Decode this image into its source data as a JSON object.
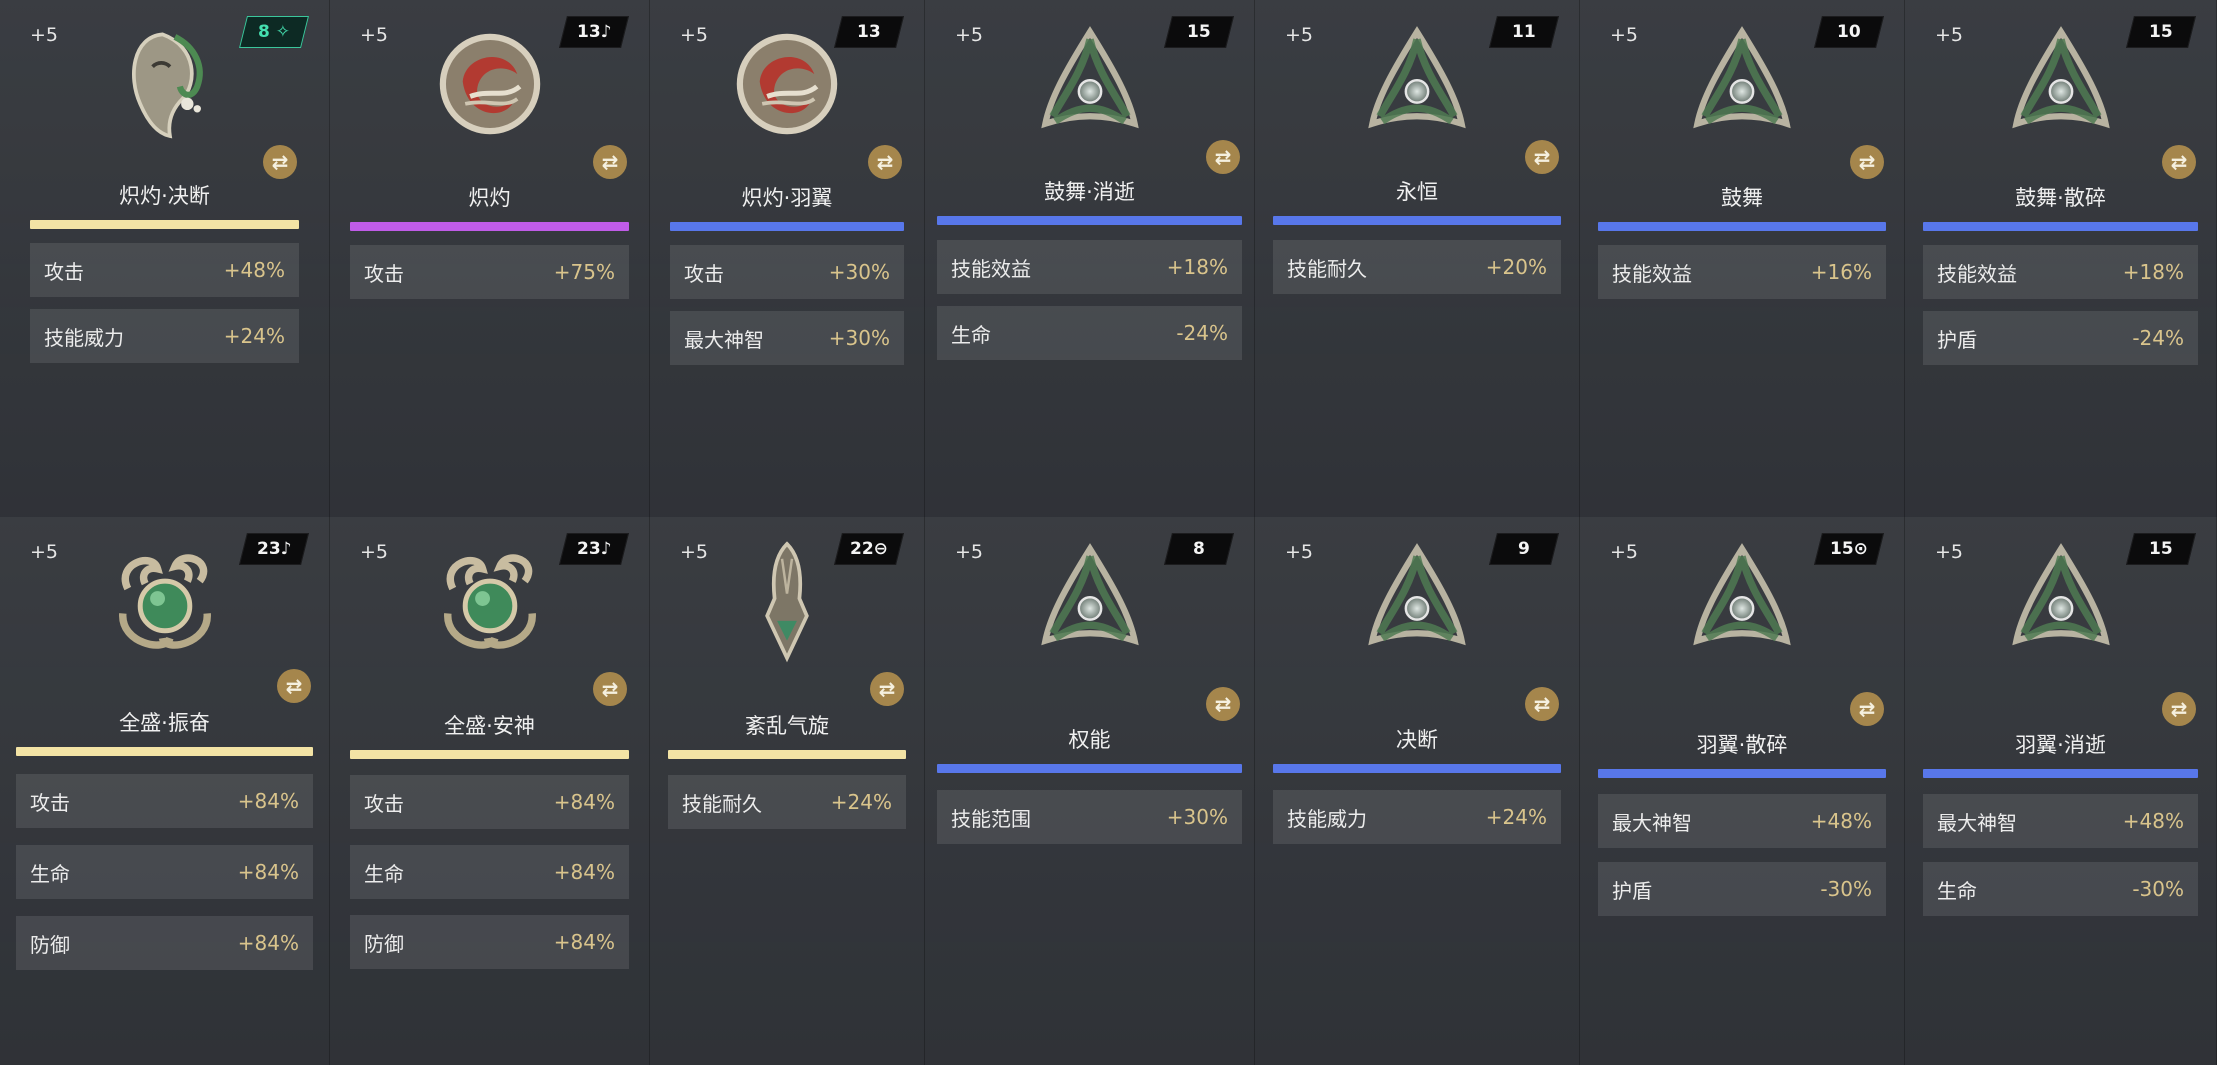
{
  "colors": {
    "gold": "#f3e3a5",
    "purple": "#c05ce8",
    "blue": "#5877ea",
    "value": "#d9c48c",
    "swap": "#a5864c"
  },
  "cards": [
    {
      "level": "+5",
      "badge": "8 ✧",
      "badge_style": "green",
      "icon": "mask-icon",
      "name": "炽灼·决断",
      "bar": "gold",
      "stats": [
        {
          "label": "攻击",
          "value": "+48%"
        },
        {
          "label": "技能威力",
          "value": "+24%"
        }
      ]
    },
    {
      "level": "+5",
      "badge": "13♪",
      "badge_style": "dark",
      "icon": "swirl-icon",
      "name": "炽灼",
      "bar": "purple",
      "stats": [
        {
          "label": "攻击",
          "value": "+75%"
        }
      ]
    },
    {
      "level": "+5",
      "badge": "13",
      "badge_style": "dark",
      "icon": "swirl-icon",
      "name": "炽灼·羽翼",
      "bar": "blue",
      "stats": [
        {
          "label": "攻击",
          "value": "+30%"
        },
        {
          "label": "最大神智",
          "value": "+30%"
        }
      ]
    },
    {
      "level": "+5",
      "badge": "15",
      "badge_style": "dark",
      "icon": "triquetra-icon",
      "name": "鼓舞·消逝",
      "bar": "blue",
      "stats": [
        {
          "label": "技能效益",
          "value": "+18%"
        },
        {
          "label": "生命",
          "value": "-24%"
        }
      ]
    },
    {
      "level": "+5",
      "badge": "11",
      "badge_style": "dark",
      "icon": "triquetra-icon",
      "name": "永恒",
      "bar": "blue",
      "stats": [
        {
          "label": "技能耐久",
          "value": "+20%"
        }
      ]
    },
    {
      "level": "+5",
      "badge": "10",
      "badge_style": "dark",
      "icon": "triquetra-icon",
      "name": "鼓舞",
      "bar": "blue",
      "stats": [
        {
          "label": "技能效益",
          "value": "+16%"
        }
      ]
    },
    {
      "level": "+5",
      "badge": "15",
      "badge_style": "dark",
      "icon": "triquetra-icon",
      "name": "鼓舞·散碎",
      "bar": "blue",
      "stats": [
        {
          "label": "技能效益",
          "value": "+18%"
        },
        {
          "label": "护盾",
          "value": "-24%"
        }
      ]
    },
    {
      "level": "+5",
      "badge": "23♪",
      "badge_style": "dark",
      "icon": "serpent-orb-icon",
      "name": "全盛·振奋",
      "bar": "gold",
      "stats": [
        {
          "label": "攻击",
          "value": "+84%"
        },
        {
          "label": "生命",
          "value": "+84%"
        },
        {
          "label": "防御",
          "value": "+84%"
        }
      ]
    },
    {
      "level": "+5",
      "badge": "23♪",
      "badge_style": "dark",
      "icon": "serpent-orb-icon",
      "name": "全盛·安神",
      "bar": "gold",
      "stats": [
        {
          "label": "攻击",
          "value": "+84%"
        },
        {
          "label": "生命",
          "value": "+84%"
        },
        {
          "label": "防御",
          "value": "+84%"
        }
      ]
    },
    {
      "level": "+5",
      "badge": "22⊖",
      "badge_style": "dark",
      "icon": "pendant-icon",
      "name": "紊乱气旋",
      "bar": "gold",
      "stats": [
        {
          "label": "技能耐久",
          "value": "+24%"
        }
      ]
    },
    {
      "level": "+5",
      "badge": "8",
      "badge_style": "dark",
      "icon": "triquetra-icon",
      "name": "权能",
      "bar": "blue",
      "stats": [
        {
          "label": "技能范围",
          "value": "+30%"
        }
      ]
    },
    {
      "level": "+5",
      "badge": "9",
      "badge_style": "dark",
      "icon": "triquetra-icon",
      "name": "决断",
      "bar": "blue",
      "stats": [
        {
          "label": "技能威力",
          "value": "+24%"
        }
      ]
    },
    {
      "level": "+5",
      "badge": "15⊙",
      "badge_style": "dark",
      "icon": "triquetra-icon",
      "name": "羽翼·散碎",
      "bar": "blue",
      "stats": [
        {
          "label": "最大神智",
          "value": "+48%"
        },
        {
          "label": "护盾",
          "value": "-30%"
        }
      ]
    },
    {
      "level": "+5",
      "badge": "15",
      "badge_style": "dark",
      "icon": "triquetra-icon",
      "name": "羽翼·消逝",
      "bar": "blue",
      "stats": [
        {
          "label": "最大神智",
          "value": "+48%"
        },
        {
          "label": "生命",
          "value": "-30%"
        }
      ]
    }
  ]
}
